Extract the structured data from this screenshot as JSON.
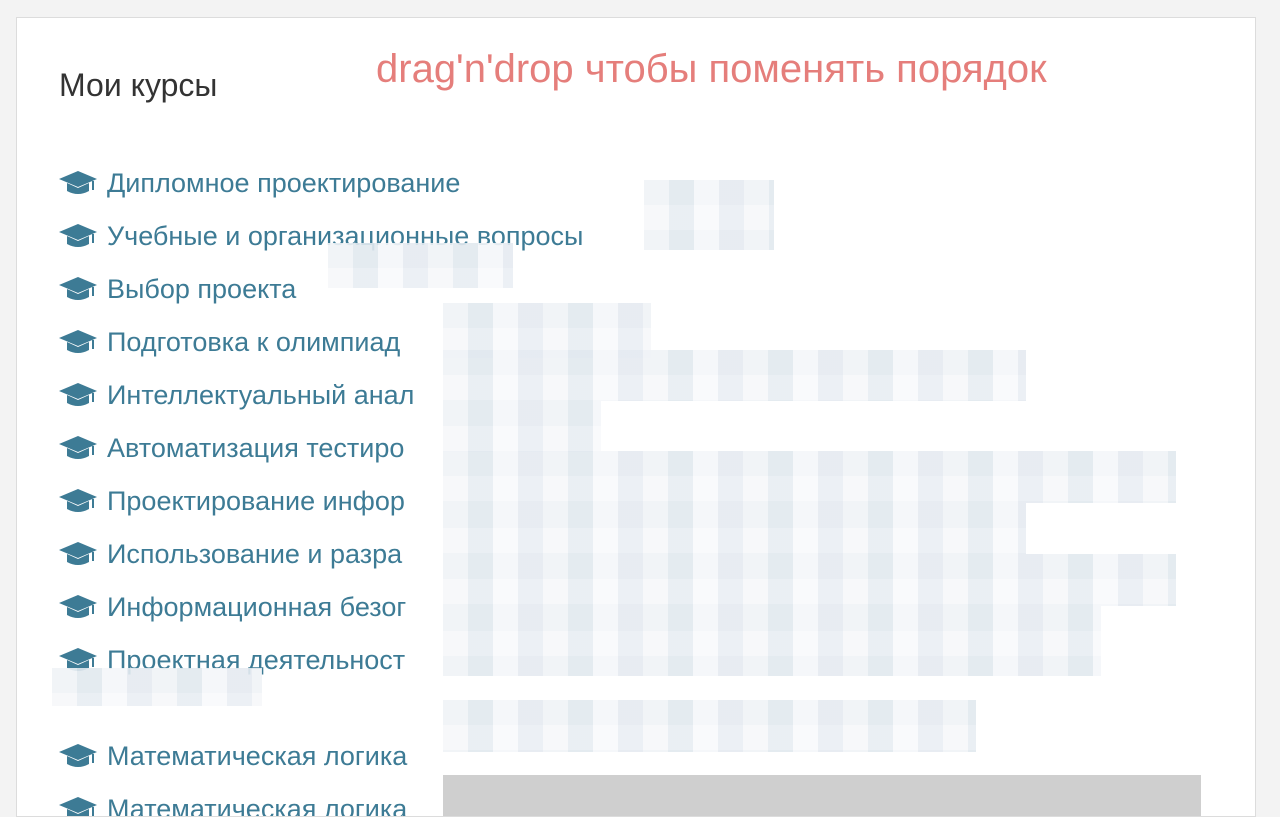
{
  "page": {
    "title": "Мои курсы",
    "hint": "drag'n'drop чтобы поменять порядок"
  },
  "courses": [
    {
      "label": "Дипломное проектирование",
      "icon": "graduation-cap-icon"
    },
    {
      "label": "Учебные и организационные вопросы",
      "icon": "graduation-cap-icon"
    },
    {
      "label": "Выбор проекта",
      "icon": "graduation-cap-icon"
    },
    {
      "label": "Подготовка к олимпиад",
      "icon": "graduation-cap-icon"
    },
    {
      "label": "Интеллектуальный анал",
      "icon": "graduation-cap-icon"
    },
    {
      "label": "Автоматизация тестиро",
      "icon": "graduation-cap-icon"
    },
    {
      "label": "Проектирование инфор",
      "icon": "graduation-cap-icon"
    },
    {
      "label": "Использование и разра",
      "icon": "graduation-cap-icon"
    },
    {
      "label": "Информационная безог",
      "icon": "graduation-cap-icon"
    },
    {
      "label": "Проектная деятельност",
      "icon": "graduation-cap-icon"
    },
    {
      "label": "Математическая логика",
      "icon": "graduation-cap-icon"
    },
    {
      "label": "Математическая логика",
      "icon": "graduation-cap-icon"
    }
  ],
  "colors": {
    "link": "#3d7b95",
    "hint": "#e57e7b",
    "title": "#333333"
  }
}
